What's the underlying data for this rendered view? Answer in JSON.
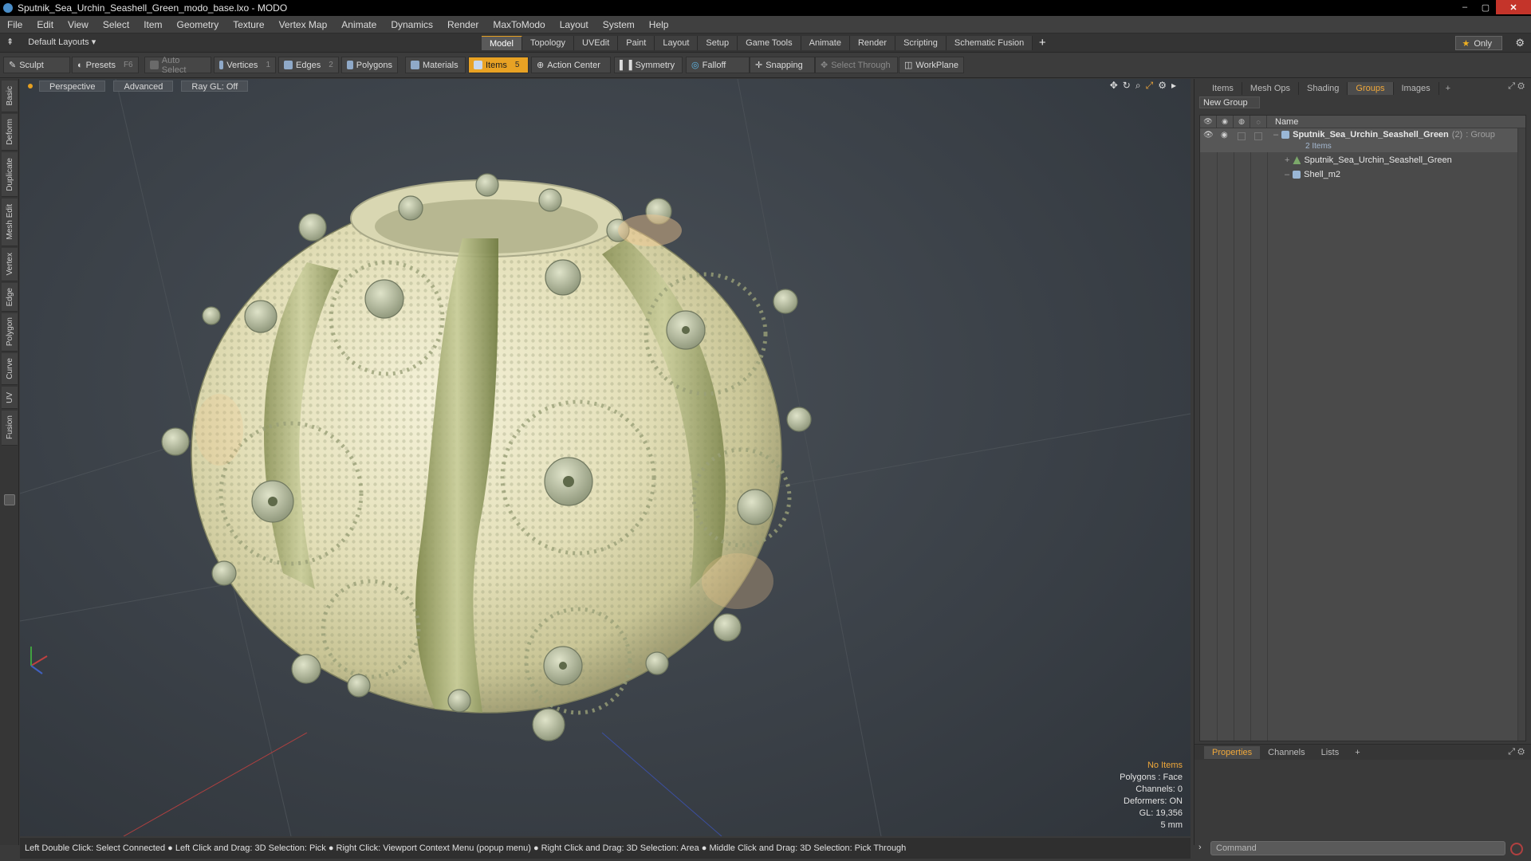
{
  "window": {
    "title": "Sputnik_Sea_Urchin_Seashell_Green_modo_base.lxo - MODO",
    "controls": [
      "–",
      "▢",
      "✕"
    ]
  },
  "menu": [
    "File",
    "Edit",
    "View",
    "Select",
    "Item",
    "Geometry",
    "Texture",
    "Vertex Map",
    "Animate",
    "Dynamics",
    "Render",
    "MaxToModo",
    "Layout",
    "System",
    "Help"
  ],
  "layouts": {
    "label": "Default Layouts ▾",
    "tabs": [
      "Model",
      "Topology",
      "UVEdit",
      "Paint",
      "Layout",
      "Setup",
      "Game Tools",
      "Animate",
      "Render",
      "Scripting",
      "Schematic Fusion"
    ],
    "active_tab": "Model",
    "add": "+",
    "only_label": "Only",
    "star": "★"
  },
  "toolbar": {
    "sculpt": "Sculpt",
    "presets": "Presets",
    "presets_key": "F6",
    "auto_select": "Auto Select",
    "vertices": "Vertices",
    "vertices_count": "1",
    "edges": "Edges",
    "edges_count": "2",
    "polygons": "Polygons",
    "materials": "Materials",
    "items": "Items",
    "items_count": "5",
    "action_center": "Action Center",
    "symmetry": "Symmetry",
    "falloff": "Falloff",
    "snapping": "Snapping",
    "select_through": "Select Through",
    "workplane": "WorkPlane"
  },
  "left_tabs": [
    "Basic",
    "Deform",
    "Duplicate",
    "Mesh Edit",
    "Vertex",
    "Edge",
    "Polygon",
    "Curve",
    "UV",
    "Fusion"
  ],
  "viewport": {
    "view": "Perspective",
    "shading": "Advanced",
    "raygl": "Ray GL: Off",
    "icons": [
      "move-icon",
      "rotate-icon",
      "zoom-icon",
      "maximize-icon",
      "gear-icon",
      "arrow-right-icon"
    ],
    "info": {
      "selection": "No Items",
      "polygons": "Polygons : Face",
      "channels": "Channels: 0",
      "deformers": "Deformers: ON",
      "gl": "GL: 19,356",
      "scale": "5 mm"
    }
  },
  "right_panel": {
    "tabs": [
      "Items",
      "Mesh Ops",
      "Shading",
      "Groups",
      "Images"
    ],
    "active_tab": "Groups",
    "add": "+",
    "new_group": "New Group",
    "name_header": "Name",
    "group_name": "Sputnik_Sea_Urchin_Seashell_Green",
    "group_count": "(2)",
    "group_type": ": Group",
    "group_sub": "2 Items",
    "children": [
      "Sputnik_Sea_Urchin_Seashell_Green",
      "Shell_m2"
    ],
    "lower_tabs": [
      "Properties",
      "Channels",
      "Lists"
    ],
    "lower_active": "Properties"
  },
  "statusbar": {
    "hint": "Left Double Click: Select Connected ● Left Click and Drag: 3D Selection: Pick ● Right Click: Viewport Context Menu (popup menu) ● Right Click and Drag: 3D Selection: Area ● Middle Click and Drag: 3D Selection: Pick Through"
  },
  "command": {
    "placeholder": "Command"
  },
  "colors": {
    "accent": "#e8a224",
    "shell_base": "#e8e6c4",
    "shell_band": "#8f9b5a",
    "viewport_bg": "#3b4148"
  }
}
